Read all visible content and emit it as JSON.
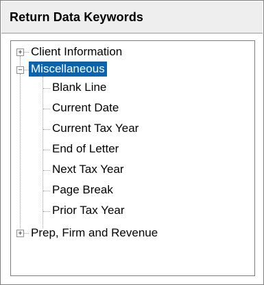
{
  "panel": {
    "title": "Return Data Keywords"
  },
  "tree": {
    "nodes": [
      {
        "label": "Client Information",
        "expanded": false,
        "selected": false
      },
      {
        "label": "Miscellaneous",
        "expanded": true,
        "selected": true,
        "children": [
          "Blank Line",
          "Current Date",
          "Current Tax Year",
          "End of Letter",
          "Next Tax Year",
          "Page Break",
          "Prior Tax Year"
        ]
      },
      {
        "label": "Prep, Firm and Revenue",
        "expanded": false,
        "selected": false
      }
    ],
    "toggle_collapsed": "+",
    "toggle_expanded": "−",
    "colors": {
      "selection": "#0a64ad"
    }
  }
}
